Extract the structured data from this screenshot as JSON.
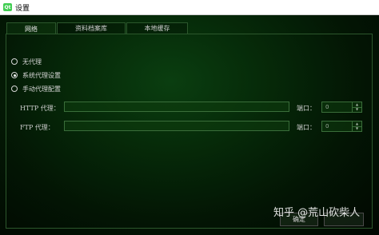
{
  "window": {
    "icon_text": "Qt",
    "title": "设置"
  },
  "tabs": [
    {
      "label": "网络"
    },
    {
      "label": "资料档案库"
    },
    {
      "label": "本地缓存"
    }
  ],
  "proxy_options": [
    {
      "label": "无代理",
      "checked": false
    },
    {
      "label": "系统代理设置",
      "checked": true
    },
    {
      "label": "手动代理配置",
      "checked": false
    }
  ],
  "http": {
    "label": "HTTP 代理：",
    "value": "",
    "port_label": "端口：",
    "port_value": "0"
  },
  "ftp": {
    "label": "FTP 代理：",
    "value": "",
    "port_label": "端口：",
    "port_value": "0"
  },
  "buttons": {
    "ok_label": "确定"
  },
  "watermark": "知乎 @荒山砍柴人"
}
